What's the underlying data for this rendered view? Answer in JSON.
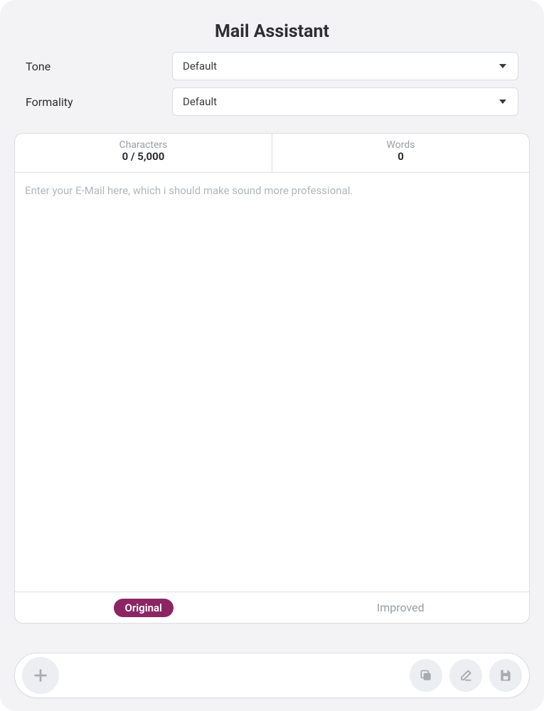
{
  "title": "Mail Assistant",
  "fields": {
    "tone": {
      "label": "Tone",
      "value": "Default"
    },
    "formality": {
      "label": "Formality",
      "value": "Default"
    }
  },
  "stats": {
    "characters": {
      "label": "Characters",
      "value": "0 / 5,000"
    },
    "words": {
      "label": "Words",
      "value": "0"
    }
  },
  "editor": {
    "placeholder": "Enter your E-Mail here, which i should make sound more professional.",
    "value": ""
  },
  "tabs": {
    "original": "Original",
    "improved": "Improved"
  }
}
